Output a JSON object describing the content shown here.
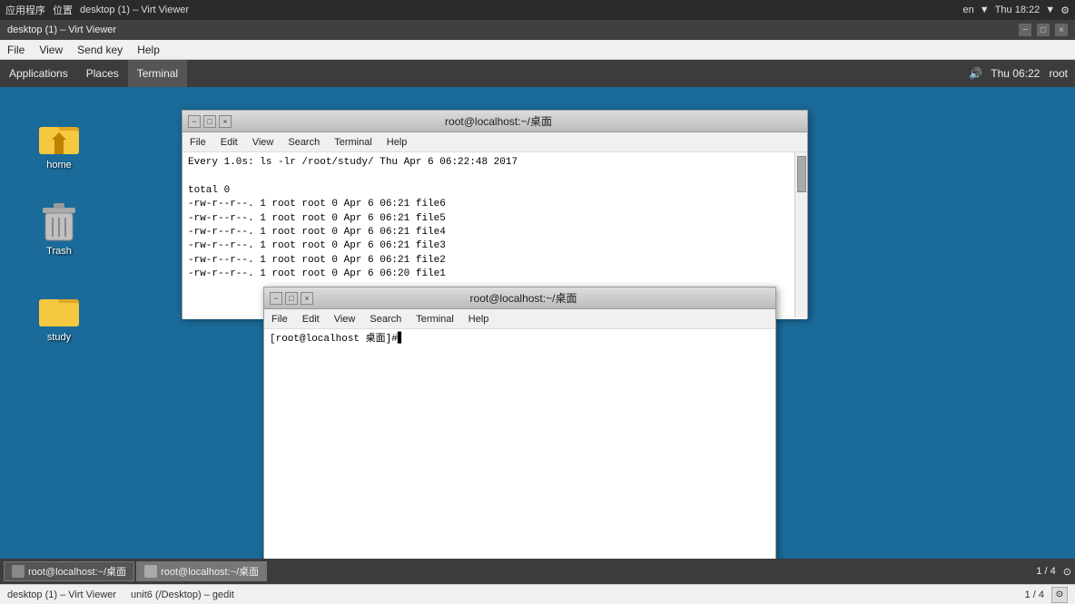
{
  "system_bar": {
    "left_items": [
      "应用程序",
      "位置",
      "desktop (1) - Virt Viewer"
    ],
    "right_items": [
      "en",
      "▼",
      "Thu 18:22",
      "▼",
      "⚙"
    ]
  },
  "virt_viewer": {
    "title": "desktop (1) – Virt Viewer",
    "menu": {
      "file": "File",
      "view": "View",
      "send_key": "Send key",
      "help": "Help"
    },
    "window_controls": {
      "minimize": "−",
      "maximize": "□",
      "close": "×"
    }
  },
  "gnome_panel": {
    "applications": "Applications",
    "places": "Places",
    "terminal_label": "Terminal",
    "clock": "Thu 06:22",
    "user": "root",
    "volume": "🔊"
  },
  "desktop": {
    "icons": [
      {
        "id": "home",
        "label": "home"
      },
      {
        "id": "trash",
        "label": "Trash"
      },
      {
        "id": "study",
        "label": "study"
      }
    ]
  },
  "terminal_bg": {
    "title": "root@localhost:~/桌面",
    "menu": {
      "file": "File",
      "edit": "Edit",
      "view": "View",
      "search": "Search",
      "terminal": "Terminal",
      "help": "Help"
    },
    "content_lines": [
      "Every 1.0s: ls -lr /root/study/                                    Thu Apr  6 06:22:48 2017",
      "",
      "total 0",
      "-rw-r--r--. 1 root root 0 Apr  6 06:21 file6",
      "-rw-r--r--. 1 root root 0 Apr  6 06:21 file5",
      "-rw-r--r--. 1 root root 0 Apr  6 06:21 file4",
      "-rw-r--r--. 1 root root 0 Apr  6 06:21 file3",
      "-rw-r--r--. 1 root root 0 Apr  6 06:21 file2",
      "-rw-r--r--. 1 root root 0 Apr  6 06:20 file1"
    ],
    "window_controls": {
      "minimize": "−",
      "maximize": "□",
      "close": "×"
    }
  },
  "terminal_fg": {
    "title": "root@localhost:~/桌面",
    "menu": {
      "file": "File",
      "edit": "Edit",
      "view": "View",
      "search": "Search",
      "terminal": "Terminal",
      "help": "Help"
    },
    "prompt": "[root@localhost 桌面]# ",
    "cursor": "▋",
    "window_controls": {
      "minimize": "−",
      "maximize": "□",
      "close": "×"
    }
  },
  "taskbar": {
    "items": [
      {
        "id": "taskbar-terminal1",
        "label": "root@localhost:~/桌面"
      },
      {
        "id": "taskbar-terminal2",
        "label": "root@localhost:~/桌面"
      }
    ],
    "right": {
      "page_indicator": "1 / 4",
      "icon": "⊙"
    }
  },
  "virt_bottom_bar": {
    "left_items": [
      "desktop (1) – Virt Viewer",
      "unit6 (/Desktop) – gedit"
    ],
    "right": "1 / 4"
  }
}
